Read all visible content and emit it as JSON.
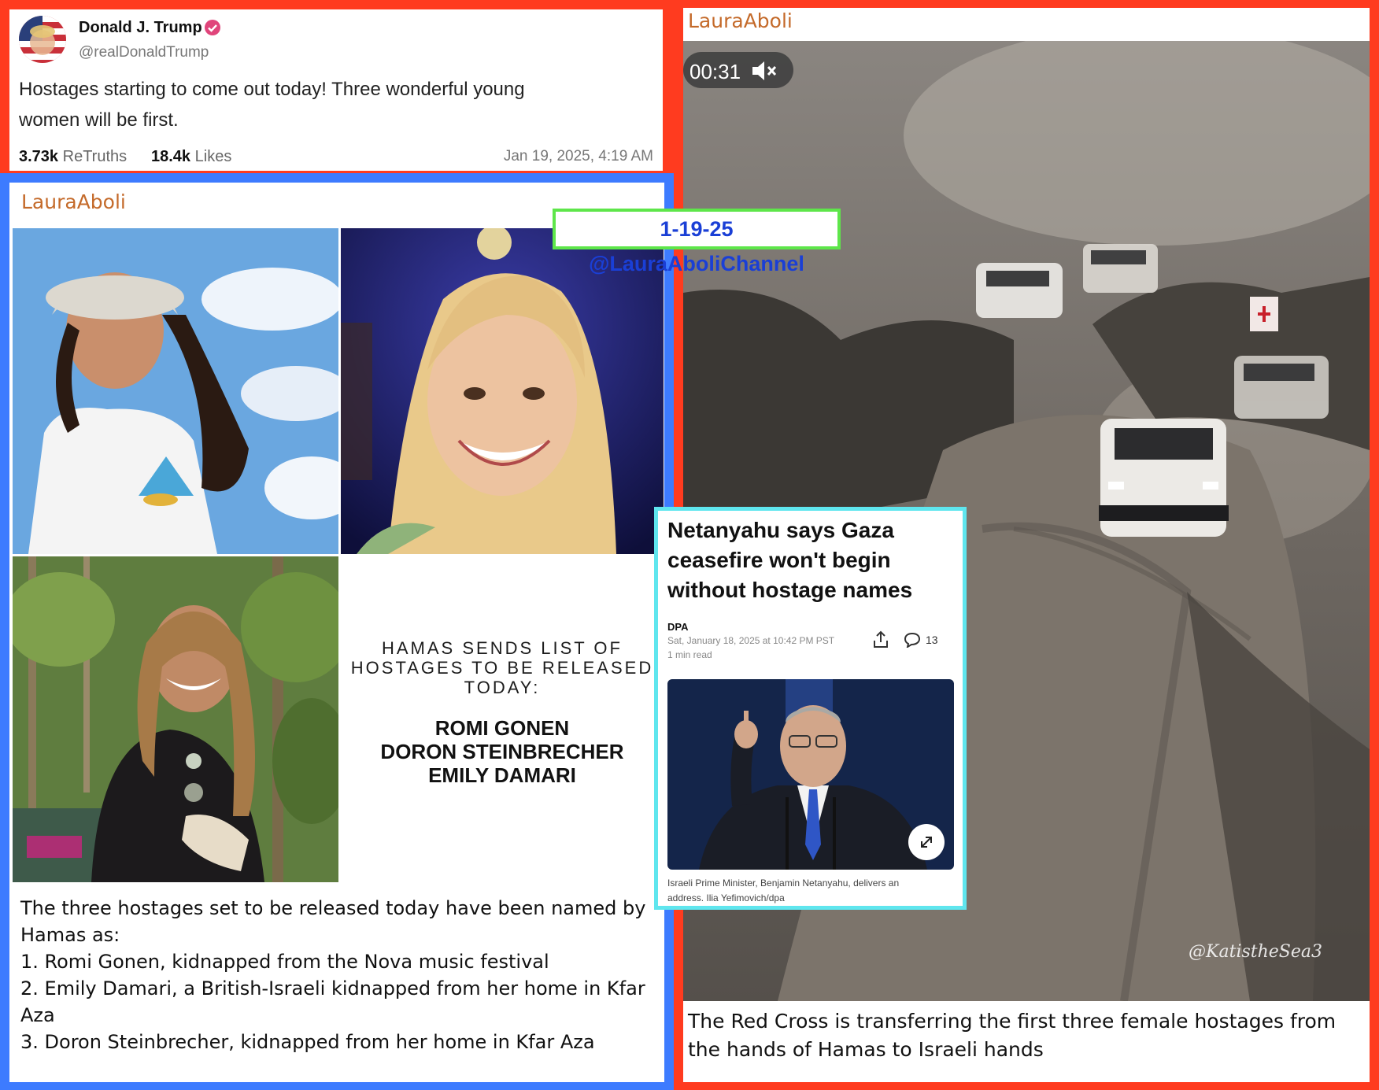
{
  "truth_post": {
    "display_name": "Donald J. Trump",
    "handle": "@realDonaldTrump",
    "body_line1": "Hostages starting to come out today! Three wonderful young",
    "body_line2": "women will be first.",
    "retruths_count": "3.73k",
    "retruths_label": "ReTruths",
    "likes_count": "18.4k",
    "likes_label": "Likes",
    "timestamp": "Jan 19, 2025, 4:19 AM"
  },
  "left_post": {
    "author": "LauraAboli",
    "overlay_tag": "1-19-25 @LauraAboliChannel",
    "graphic_heading": [
      "HAMAS SENDS LIST OF",
      "HOSTAGES TO BE RELEASED",
      "TODAY:"
    ],
    "graphic_names": [
      "ROMI GONEN",
      "DORON STEINBRECHER",
      "EMILY DAMARI"
    ],
    "caption_lines": [
      "The three hostages set to be released today have been named by",
      "Hamas as:",
      "1. Romi Gonen, kidnapped from the Nova music festival",
      "2. Emily Damari, a British-Israeli kidnapped from her home in Kfar",
      "Aza",
      "3. Doron Steinbrecher, kidnapped from her home in Kfar Aza"
    ]
  },
  "right_post": {
    "author": "LauraAboli",
    "video_time": "00:31",
    "watermark": "@KatistheSea3",
    "caption_line1": "The Red Cross is transferring the first three female hostages from",
    "caption_line2": "the hands of Hamas to Israeli hands"
  },
  "news_card": {
    "headline": [
      "Netanyahu says Gaza",
      "ceasefire won't begin",
      "without hostage names"
    ],
    "source": "DPA",
    "date": "Sat, January 18, 2025 at 10:42 PM PST",
    "read_time": "1 min read",
    "comment_count": "13",
    "image_caption_line1": "Israeli Prime Minister, Benjamin Netanyahu, delivers an",
    "image_caption_line2": "address. Ilia Yefimovich/dpa"
  },
  "colors": {
    "outer_border": "#ff3b1f",
    "left_border": "#3d7bff",
    "tag_border": "#5ee64a",
    "tag_text": "#1a3fd6",
    "news_border": "#5fe6ee",
    "author_orange": "#c46a2a",
    "verified_badge": "#e0457b"
  },
  "icons": [
    "verified-badge-icon",
    "mute-icon",
    "share-icon",
    "comment-icon",
    "expand-icon"
  ]
}
